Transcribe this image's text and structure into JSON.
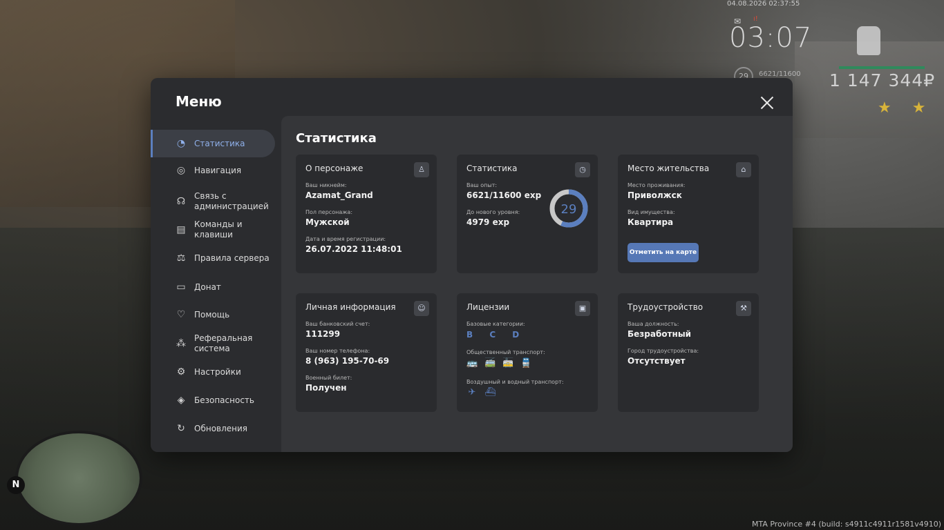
{
  "hud": {
    "datetime": "04.08.2026 02:37:55",
    "time": "03:07",
    "level": "29",
    "exp": "6621/11600",
    "money": "1 147 344₽",
    "stars": "★★",
    "build": "MTA Province #4 (build: s4911c4911r1581v4910)",
    "minimap_north": "N"
  },
  "modal": {
    "title": "Меню",
    "content_title": "Статистика"
  },
  "sidebar": {
    "items": [
      {
        "label": "Статистика",
        "icon": "pie-chart-icon"
      },
      {
        "label": "Навигация",
        "icon": "compass-icon"
      },
      {
        "label": "Связь с администрацией",
        "icon": "headset-icon"
      },
      {
        "label": "Команды и клавиши",
        "icon": "document-icon"
      },
      {
        "label": "Правила сервера",
        "icon": "scales-icon"
      },
      {
        "label": "Донат",
        "icon": "wallet-icon"
      },
      {
        "label": "Помощь",
        "icon": "heart-icon"
      },
      {
        "label": "Реферальная система",
        "icon": "referral-icon"
      },
      {
        "label": "Настройки",
        "icon": "gear-icon"
      },
      {
        "label": "Безопасность",
        "icon": "shield-icon"
      },
      {
        "label": "Обновления",
        "icon": "update-icon"
      }
    ]
  },
  "cards": {
    "character": {
      "title": "О персонаже",
      "nickname_label": "Ваш никнейм:",
      "nickname": "Azamat_Grand",
      "gender_label": "Пол персонажа:",
      "gender": "Мужской",
      "reg_label": "Дата и время регистрации:",
      "reg_date": "26.07.2022 11:48:01"
    },
    "stats": {
      "title": "Статистика",
      "exp_label": "Ваш опыт:",
      "exp": "6621/11600 exp",
      "next_label": "До нового уровня:",
      "next": "4979 exp",
      "level": "29",
      "progress": 0.57
    },
    "residence": {
      "title": "Место жительства",
      "place_label": "Место проживания:",
      "place": "Приволжск",
      "property_label": "Вид имущества:",
      "property": "Квартира",
      "map_button": "Отметить на карте"
    },
    "personal": {
      "title": "Личная информация",
      "bank_label": "Ваш банковский счет:",
      "bank": "111299",
      "phone_label": "Ваш номер телефона:",
      "phone": "8 (963) 195-70-69",
      "military_label": "Военный билет:",
      "military": "Получен"
    },
    "licenses": {
      "title": "Лицензии",
      "base_label": "Базовые категории:",
      "base": "B C D",
      "public_label": "Общественный транспорт:",
      "air_label": "Воздушный и водный транспорт:"
    },
    "job": {
      "title": "Трудоустройство",
      "position_label": "Ваша должность:",
      "position": "Безработный",
      "city_label": "Город трудоустройства:",
      "city": "Отсутствует"
    }
  },
  "colors": {
    "accent": "#5b7fbf",
    "modal_bg": "#2b2c2f",
    "content_bg": "#353639",
    "card_bg": "#2a2b2e"
  }
}
